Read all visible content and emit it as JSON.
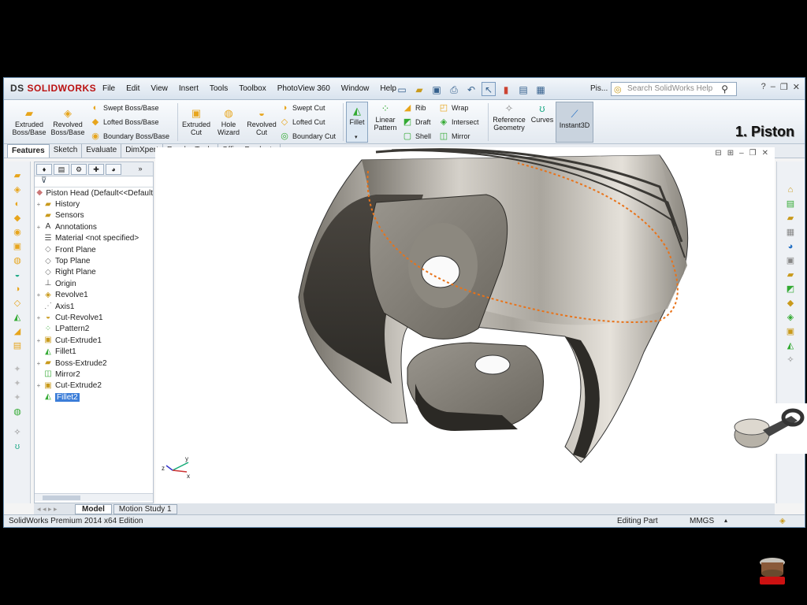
{
  "app": {
    "logo_text": "SOLIDWORKS",
    "logo_prefix": "DS",
    "menu": [
      "File",
      "Edit",
      "View",
      "Insert",
      "Tools",
      "Toolbox",
      "PhotoView 360",
      "Window",
      "Help"
    ],
    "doc_title": "Pis...",
    "search_placeholder": "Search SolidWorks Help",
    "overlay_title": "1. Piston"
  },
  "ribbon": {
    "extruded_boss": "Extruded Boss/Base",
    "revolved_boss": "Revolved Boss/Base",
    "swept_boss": "Swept Boss/Base",
    "lofted_boss": "Lofted Boss/Base",
    "boundary_boss": "Boundary Boss/Base",
    "extruded_cut": "Extruded Cut",
    "hole_wizard": "Hole Wizard",
    "revolved_cut": "Revolved Cut",
    "swept_cut": "Swept Cut",
    "lofted_cut": "Lofted Cut",
    "boundary_cut": "Boundary Cut",
    "fillet": "Fillet",
    "linear_pattern": "Linear Pattern",
    "rib": "Rib",
    "draft": "Draft",
    "shell": "Shell",
    "wrap": "Wrap",
    "intersect": "Intersect",
    "mirror": "Mirror",
    "reference_geometry": "Reference Geometry",
    "curves": "Curves",
    "instant3d": "Instant3D"
  },
  "tabs": [
    "Features",
    "Sketch",
    "Evaluate",
    "DimXpert",
    "Render Tools",
    "Office Products"
  ],
  "tree": {
    "root": "Piston Head  (Default<<Default",
    "items": [
      {
        "label": "History",
        "icon": "folder-icon",
        "expand": "+"
      },
      {
        "label": "Sensors",
        "icon": "folder-icon",
        "expand": ""
      },
      {
        "label": "Annotations",
        "icon": "annotation-icon",
        "expand": "+"
      },
      {
        "label": "Material <not specified>",
        "icon": "material-icon",
        "expand": ""
      },
      {
        "label": "Front Plane",
        "icon": "plane-icon",
        "expand": ""
      },
      {
        "label": "Top Plane",
        "icon": "plane-icon",
        "expand": ""
      },
      {
        "label": "Right Plane",
        "icon": "plane-icon",
        "expand": ""
      },
      {
        "label": "Origin",
        "icon": "origin-icon",
        "expand": ""
      },
      {
        "label": "Revolve1",
        "icon": "revolve-icon",
        "expand": "+"
      },
      {
        "label": "Axis1",
        "icon": "axis-icon",
        "expand": ""
      },
      {
        "label": "Cut-Revolve1",
        "icon": "cut-revolve-icon",
        "expand": "+"
      },
      {
        "label": "LPattern2",
        "icon": "pattern-icon",
        "expand": ""
      },
      {
        "label": "Cut-Extrude1",
        "icon": "cut-extrude-icon",
        "expand": "+"
      },
      {
        "label": "Fillet1",
        "icon": "fillet-icon",
        "expand": ""
      },
      {
        "label": "Boss-Extrude2",
        "icon": "boss-extrude-icon",
        "expand": "+"
      },
      {
        "label": "Mirror2",
        "icon": "mirror-icon",
        "expand": ""
      },
      {
        "label": "Cut-Extrude2",
        "icon": "cut-extrude-icon",
        "expand": "+"
      },
      {
        "label": "Fillet2",
        "icon": "fillet-icon",
        "expand": "",
        "selected": true
      }
    ]
  },
  "bottom_tabs": {
    "model": "Model",
    "motion": "Motion Study 1"
  },
  "status": {
    "edition": "SolidWorks Premium 2014 x64 Edition",
    "mode": "Editing Part",
    "units": "MMGS"
  },
  "colors": {
    "accent": "#3b7dd8",
    "title_bg": "#dfe7ef",
    "selection_orange": "#e8731a"
  }
}
